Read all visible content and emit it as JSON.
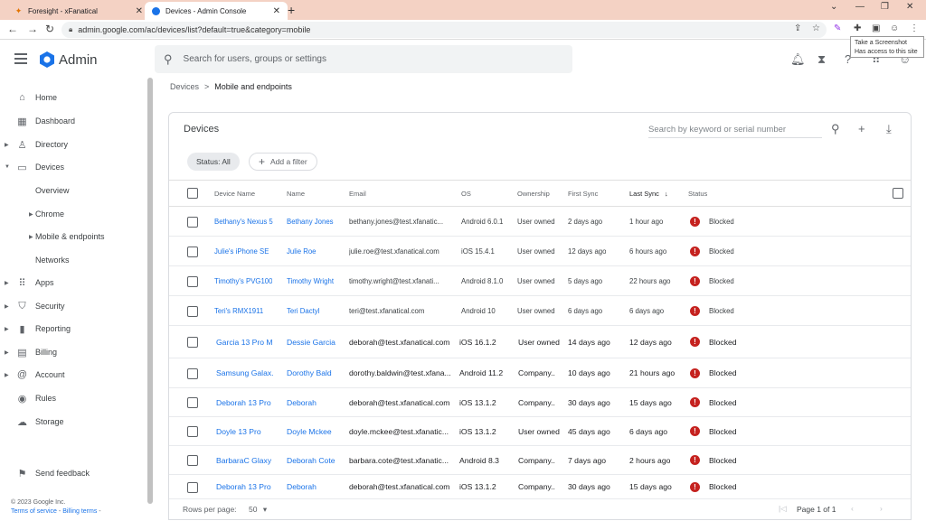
{
  "browser": {
    "tabs": [
      {
        "title": "Foresight - xFanatical",
        "active": false
      },
      {
        "title": "Devices - Admin Console",
        "active": true
      }
    ],
    "url": "admin.google.com/ac/devices/list?default=true&category=mobile",
    "tooltip": {
      "line1": "Take a Screenshot",
      "line2": "Has access to this site"
    }
  },
  "header": {
    "app_title": "Admin",
    "search_placeholder": "Search for users, groups or settings"
  },
  "sidebar": {
    "items": [
      {
        "label": "Home",
        "icon": "home-icon"
      },
      {
        "label": "Dashboard",
        "icon": "dashboard-icon"
      },
      {
        "label": "Directory",
        "icon": "person-icon"
      },
      {
        "label": "Devices",
        "icon": "devices-icon"
      },
      {
        "label": "Overview"
      },
      {
        "label": "Chrome"
      },
      {
        "label": "Mobile & endpoints"
      },
      {
        "label": "Networks"
      },
      {
        "label": "Apps",
        "icon": "apps-grid-icon"
      },
      {
        "label": "Security",
        "icon": "shield-icon"
      },
      {
        "label": "Reporting",
        "icon": "bar-chart-icon"
      },
      {
        "label": "Billing",
        "icon": "billing-icon"
      },
      {
        "label": "Account",
        "icon": "at-icon"
      },
      {
        "label": "Rules",
        "icon": "rules-icon"
      },
      {
        "label": "Storage",
        "icon": "cloud-icon"
      }
    ],
    "send_feedback": "Send feedback",
    "copyright": "© 2023 Google Inc.",
    "terms": "Terms of service",
    "sep": " - ",
    "billing_terms": "Billing terms",
    "trail": " -"
  },
  "breadcrumb": {
    "parent": "Devices",
    "sep": ">",
    "current": "Mobile and endpoints"
  },
  "card": {
    "title": "Devices",
    "search_placeholder": "Search by keyword or serial number",
    "status_chip": "Status: All",
    "add_filter": "Add a filter",
    "columns": [
      "Device Name",
      "Name",
      "Email",
      "OS",
      "Ownership",
      "First Sync",
      "Last Sync",
      "Status"
    ],
    "rows": [
      {
        "device": "Bethany's Nexus 5",
        "name": "Bethany Jones",
        "email": "bethany.jones@test.xfanatic...",
        "os": "Android 6.0.1",
        "ownership": "User owned",
        "first_sync": "2 days ago",
        "last_sync": "1 hour ago",
        "status": "Blocked"
      },
      {
        "device": "Julie's iPhone SE",
        "name": "Julie Roe",
        "email": "julie.roe@test.xfanatical.com",
        "os": "iOS 15.4.1",
        "ownership": "User owned",
        "first_sync": "12 days ago",
        "last_sync": "6 hours ago",
        "status": "Blocked"
      },
      {
        "device": "Timothy's PVG100",
        "name": "Timothy Wright",
        "email": "timothy.wright@test.xfanati...",
        "os": "Android 8.1.0",
        "ownership": "User owned",
        "first_sync": "5 days ago",
        "last_sync": "22 hours ago",
        "status": "Blocked"
      },
      {
        "device": "Teri's RMX1911",
        "name": "Teri Dactyl",
        "email": "teri@test.xfanatical.com",
        "os": "Android 10",
        "ownership": "User owned",
        "first_sync": "6 days ago",
        "last_sync": "6 days ago",
        "status": "Blocked"
      },
      {
        "device": "Garcia 13 Pro M",
        "name": "Dessie Garcia",
        "email": "deborah@test.xfanatical.com",
        "os": "iOS 16.1.2",
        "ownership": "User owned",
        "first_sync": "14 days ago",
        "last_sync": "12 days ago",
        "status": "Blocked"
      },
      {
        "device": "Samsung Galax.",
        "name": "Dorothy Bald",
        "email": "dorothy.baldwin@test.xfana...",
        "os": "Android 11.2",
        "ownership": "Company..",
        "first_sync": "10 days ago",
        "last_sync": "21 hours ago",
        "status": "Blocked"
      },
      {
        "device": "Deborah 13 Pro",
        "name": "Deborah",
        "email": "deborah@test.xfanatical.com",
        "os": "iOS 13.1.2",
        "ownership": "Company..",
        "first_sync": "30 days ago",
        "last_sync": "15 days ago",
        "status": "Blocked"
      },
      {
        "device": "Doyle 13 Pro",
        "name": "Doyle Mckee",
        "email": "doyle.mckee@test.xfanatic...",
        "os": "iOS 13.1.2",
        "ownership": "User owned",
        "first_sync": "45 days ago",
        "last_sync": "6 days ago",
        "status": "Blocked"
      },
      {
        "device": "BarbaraC Glaxy",
        "name": "Deborah Cote",
        "email": "barbara.cote@test.xfanatic...",
        "os": "Android 8.3",
        "ownership": "Company..",
        "first_sync": "7 days ago",
        "last_sync": "2 hours ago",
        "status": "Blocked"
      },
      {
        "device": "Deborah 13 Pro",
        "name": "Deborah",
        "email": "deborah@test.xfanatical.com",
        "os": "iOS 13.1.2",
        "ownership": "Company..",
        "first_sync": "30 days ago",
        "last_sync": "15 days ago",
        "status": "Blocked"
      }
    ],
    "rows_per_page_label": "Rows per page:",
    "rows_per_page_value": "50",
    "page_label": "Page 1 of 1"
  }
}
